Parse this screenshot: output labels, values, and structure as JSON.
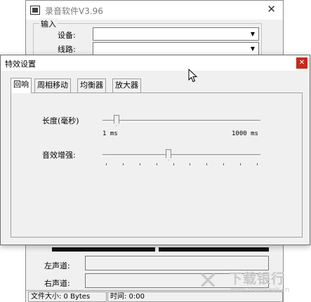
{
  "main_window": {
    "title": "录音软件V3.96",
    "close_glyph": "✕",
    "input_group": {
      "legend": "输入",
      "device_label": "设备:",
      "device_value": "",
      "line_label": "线路:",
      "line_value": ""
    },
    "left_channel_label": "左声道:",
    "right_channel_label": "右声道:",
    "status": {
      "file_size": "文件大小: 0 Bytes",
      "time": "时间: 0:00"
    }
  },
  "dialog": {
    "title": "特效设置",
    "close_glyph": "✕",
    "tabs": [
      {
        "label": "回响",
        "active": true
      },
      {
        "label": "周相移动",
        "active": false
      },
      {
        "label": "均衡器",
        "active": false
      },
      {
        "label": "放大器",
        "active": false
      }
    ],
    "length_label": "长度(毫秒)",
    "length_min": "1 ms",
    "length_max": "1000 ms",
    "length_value": 1,
    "length_range": [
      1,
      1000
    ],
    "enhance_label": "音效增强:",
    "enhance_value": 0.4,
    "enhance_ticks": 10
  },
  "watermark": {
    "mark": "✕",
    "main": "下载银行",
    "sub": "www.downbank.cn"
  },
  "icons": [
    "app-icon",
    "close-icon",
    "dropdown-arrow-icon",
    "cursor-icon",
    "watermark-logo-icon"
  ]
}
